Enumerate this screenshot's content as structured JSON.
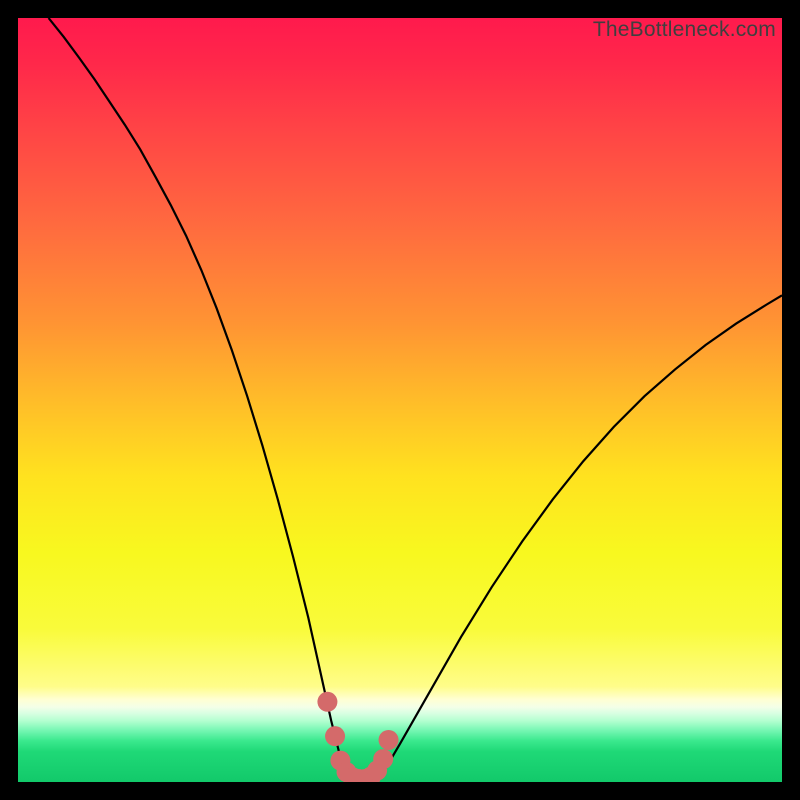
{
  "watermark": "TheBottleneck.com",
  "colors": {
    "frame": "#000000",
    "curve": "#000000",
    "markers": "#d46a6a"
  },
  "chart_data": {
    "type": "line",
    "title": "",
    "xlabel": "",
    "ylabel": "",
    "xlim": [
      0,
      100
    ],
    "ylim": [
      0,
      100
    ],
    "series": [
      {
        "name": "bottleneck-curve",
        "x": [
          4,
          6,
          8,
          10,
          12,
          14,
          16,
          18,
          20,
          22,
          24,
          26,
          28,
          30,
          32,
          34,
          36,
          38,
          40,
          41,
          42,
          43,
          44,
          45,
          46,
          47,
          48,
          50,
          54,
          58,
          62,
          66,
          70,
          74,
          78,
          82,
          86,
          90,
          94,
          98,
          100
        ],
        "y": [
          100,
          97.5,
          94.8,
          92,
          89,
          86,
          82.8,
          79.2,
          75.5,
          71.5,
          67,
          62,
          56.5,
          50.5,
          44,
          37,
          29.5,
          21.5,
          12.5,
          8,
          4,
          1.6,
          0.6,
          0.3,
          0.3,
          0.6,
          1.6,
          5,
          12,
          19,
          25.5,
          31.5,
          37,
          42,
          46.5,
          50.5,
          54,
          57.2,
          60,
          62.5,
          63.7
        ]
      }
    ],
    "markers": {
      "name": "bottom-highlight",
      "points": [
        {
          "x": 40.5,
          "y": 10.5
        },
        {
          "x": 41.5,
          "y": 6.0
        },
        {
          "x": 42.2,
          "y": 2.8
        },
        {
          "x": 43.0,
          "y": 1.3
        },
        {
          "x": 43.8,
          "y": 0.6
        },
        {
          "x": 44.6,
          "y": 0.4
        },
        {
          "x": 45.4,
          "y": 0.4
        },
        {
          "x": 46.2,
          "y": 0.7
        },
        {
          "x": 47.0,
          "y": 1.5
        },
        {
          "x": 47.8,
          "y": 3.0
        },
        {
          "x": 48.5,
          "y": 5.5
        }
      ]
    }
  }
}
